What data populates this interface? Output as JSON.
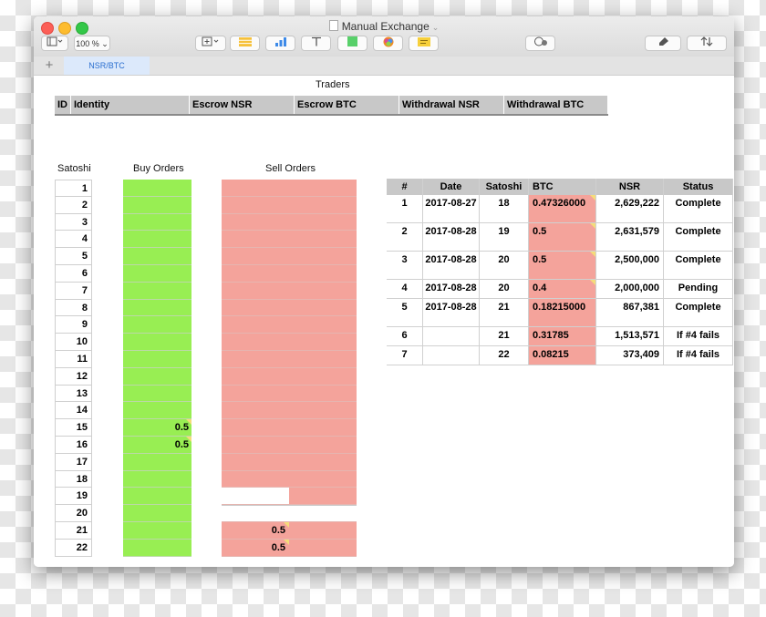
{
  "window": {
    "title": "Manual Exchange",
    "zoom": "100 %"
  },
  "sheet_tab": "NSR/BTC",
  "traders": {
    "title": "Traders",
    "headers": [
      "ID",
      "Identity",
      "Escrow NSR",
      "Escrow BTC",
      "Withdrawal NSR",
      "Withdrawal BTC"
    ]
  },
  "left": {
    "satoshi_label": "Satoshi",
    "buy_label": "Buy Orders",
    "sell_label": "Sell Orders",
    "satoshi": [
      "1",
      "2",
      "3",
      "4",
      "5",
      "6",
      "7",
      "8",
      "9",
      "10",
      "11",
      "12",
      "13",
      "14",
      "15",
      "16",
      "17",
      "18",
      "19",
      "20",
      "21",
      "22"
    ],
    "buy_values": {
      "15": "0.5",
      "16": "0.5"
    },
    "sell_values": {
      "21": "0.5",
      "22": "0.5"
    }
  },
  "orders": {
    "headers": [
      "#",
      "Date",
      "Satoshi",
      "BTC",
      "NSR",
      "Status"
    ],
    "rows": [
      [
        "1",
        "2017-08-27",
        "18",
        "0.47326000",
        "2,629,222",
        "Complete"
      ],
      [
        "2",
        "2017-08-28",
        "19",
        "0.5",
        "2,631,579",
        "Complete"
      ],
      [
        "3",
        "2017-08-28",
        "20",
        "0.5",
        "2,500,000",
        "Complete"
      ],
      [
        "4",
        "2017-08-28",
        "20",
        "0.4",
        "2,000,000",
        "Pending"
      ],
      [
        "5",
        "2017-08-28",
        "21",
        "0.18215000",
        "867,381",
        "Complete"
      ],
      [
        "6",
        "",
        "21",
        "0.31785",
        "1,513,571",
        "If #4 fails"
      ],
      [
        "7",
        "",
        "22",
        "0.08215",
        "373,409",
        "If #4 fails"
      ]
    ]
  },
  "colors": {
    "buy": "#98ee53",
    "sell": "#f4a39b",
    "header": "#c8c8c8",
    "tab": "#2b6fcf"
  }
}
